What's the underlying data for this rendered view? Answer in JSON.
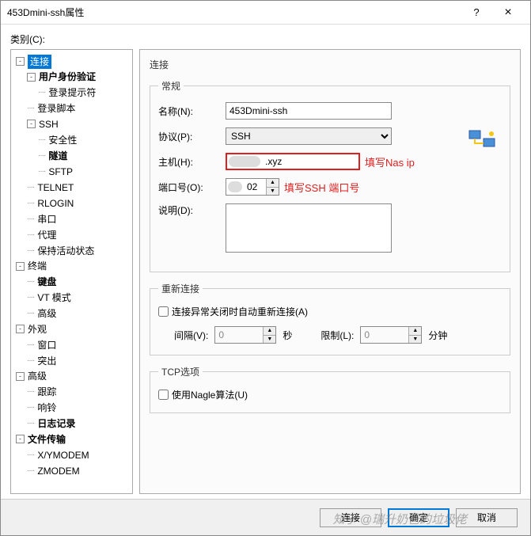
{
  "window": {
    "title": "453Dmini-ssh属性",
    "help": "?",
    "close": "×"
  },
  "labels": {
    "category": "类别(C):"
  },
  "tree": {
    "items": [
      {
        "label": "连接",
        "expand": "-",
        "selected": true,
        "children": [
          {
            "label": "用户身份验证",
            "expand": "-",
            "bold": true,
            "children": [
              {
                "label": "登录提示符"
              }
            ]
          },
          {
            "label": "登录脚本"
          },
          {
            "label": "SSH",
            "expand": "-",
            "children": [
              {
                "label": "安全性"
              },
              {
                "label": "隧道",
                "bold": true
              },
              {
                "label": "SFTP"
              }
            ]
          },
          {
            "label": "TELNET"
          },
          {
            "label": "RLOGIN"
          },
          {
            "label": "串口"
          },
          {
            "label": "代理"
          },
          {
            "label": "保持活动状态"
          }
        ]
      },
      {
        "label": "终端",
        "expand": "-",
        "children": [
          {
            "label": "键盘",
            "bold": true
          },
          {
            "label": "VT 模式"
          },
          {
            "label": "高级"
          }
        ]
      },
      {
        "label": "外观",
        "expand": "-",
        "children": [
          {
            "label": "窗口"
          },
          {
            "label": "突出"
          }
        ]
      },
      {
        "label": "高级",
        "expand": "-",
        "children": [
          {
            "label": "跟踪"
          },
          {
            "label": "响铃"
          },
          {
            "label": "日志记录",
            "bold": true
          }
        ]
      },
      {
        "label": "文件传输",
        "expand": "-",
        "bold": true,
        "children": [
          {
            "label": "X/YMODEM"
          },
          {
            "label": "ZMODEM"
          }
        ]
      }
    ]
  },
  "panel": {
    "heading": "连接",
    "general": {
      "legend": "常规",
      "name_label": "名称(N):",
      "name_value": "453Dmini-ssh",
      "proto_label": "协议(P):",
      "proto_value": "SSH",
      "host_label": "主机(H):",
      "host_value": ".xyz",
      "host_annot": "填写Nas ip",
      "port_label": "端口号(O):",
      "port_value": "02",
      "port_annot": "填写SSH 端口号",
      "desc_label": "说明(D):",
      "desc_value": ""
    },
    "reconnect": {
      "legend": "重新连接",
      "chk_label": "连接异常关闭时自动重新连接(A)",
      "interval_label": "间隔(V):",
      "interval_value": "0",
      "sec": "秒",
      "limit_label": "限制(L):",
      "limit_value": "0",
      "min": "分钟"
    },
    "tcp": {
      "legend": "TCP选项",
      "nagle_label": "使用Nagle算法(U)"
    }
  },
  "buttons": {
    "connect": "连接",
    "ok": "确定",
    "cancel": "取消"
  },
  "watermark": "知乎 @瑞升奶爸的垃圾佬"
}
